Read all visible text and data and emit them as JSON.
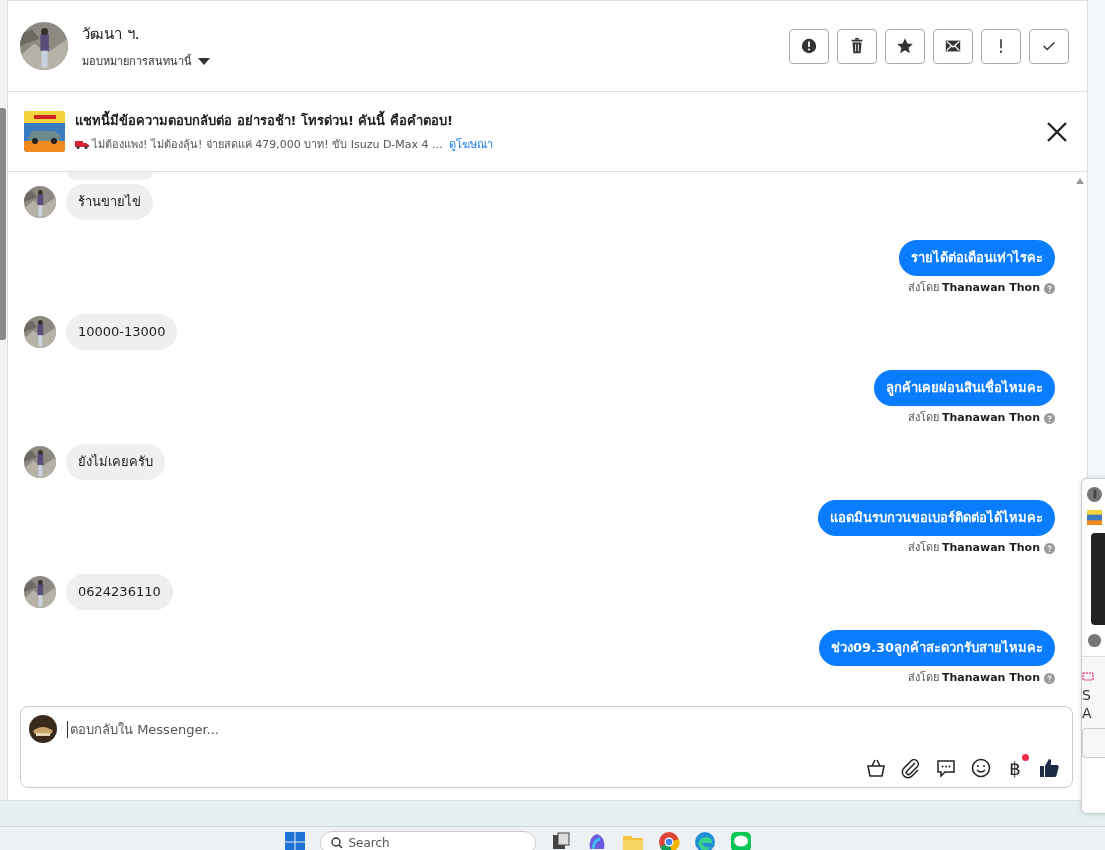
{
  "conversation": {
    "name": "วัฒนา ฯ.",
    "assign_label": "มอบหมายการสนทนานี้"
  },
  "ad": {
    "title": "แชทนี้มีข้อความตอบกลับต่อ อย่ารอช้า! โทรด่วน! คันนี้ คือคำตอบ!",
    "body": "ไม่ต้องแพง! ไม่ต้องลุ้น! จ่ายสดแค่ 479,000 บาท! ขับ Isuzu D-Max 4 ...",
    "link": "ดูโฆษณา"
  },
  "messages": [
    {
      "kind": "incoming",
      "text": "ร้านขายไข่"
    },
    {
      "kind": "outgoing",
      "text": "รายได้ต่อเดือนเท่าไรคะ",
      "sent_by": "ส่งโดย **Thanawan Thon**"
    },
    {
      "kind": "incoming",
      "text": "10000-13000"
    },
    {
      "kind": "outgoing",
      "text": "ลูกค้าเคยผ่อนสินเชื่อไหมคะ",
      "sent_by": "ส่งโดย **Thanawan Thon**"
    },
    {
      "kind": "incoming",
      "text": "ยังไม่เคยครับ"
    },
    {
      "kind": "outgoing",
      "text": "แอดมินรบกวนขอเบอร์ติดต่อได้ไหมคะ",
      "sent_by": "ส่งโดย **Thanawan Thon**"
    },
    {
      "kind": "incoming",
      "text": "0624236110"
    },
    {
      "kind": "outgoing",
      "text": "ช่วง09.30ลูกค้าสะดวกรับสายไหมคะ",
      "sent_by": "ส่งโดย **Thanawan Thon**"
    }
  ],
  "composer": {
    "placeholder": "ตอบกลับใน Messenger...",
    "currency_symbol": "฿",
    "payment_badge": true
  },
  "side_panel": {
    "lines": [
      "S",
      "A"
    ]
  },
  "taskbar": {
    "search_placeholder": "Search"
  }
}
